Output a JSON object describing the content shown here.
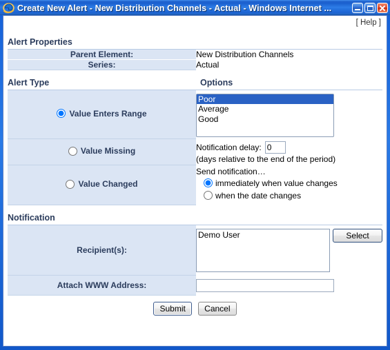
{
  "window": {
    "title": "Create New Alert - New Distribution Channels - Actual - Windows Internet ...",
    "icon": "internet-explorer-icon",
    "minimize_label": "Minimize",
    "maximize_label": "Maximize",
    "close_label": "Close",
    "titlebar_color": "#1f63d0",
    "close_button_color": "#cc2f11"
  },
  "page": {
    "help_link": "[ Help ]",
    "sections": {
      "alert_properties": {
        "heading": "Alert Properties",
        "rows": [
          {
            "label": "Parent Element:",
            "value": "New Distribution Channels"
          },
          {
            "label": "Series:",
            "value": "Actual"
          }
        ]
      },
      "alert_type": {
        "heading": "Alert Type",
        "options_heading": "Options",
        "radios": [
          {
            "label": "Value Enters Range",
            "selected": true
          },
          {
            "label": "Value Missing",
            "selected": false
          },
          {
            "label": "Value Changed",
            "selected": false
          }
        ],
        "options_list": {
          "items": [
            "Poor",
            "Average",
            "Good"
          ],
          "selected": "Poor",
          "selected_bg": "#2a62c4"
        },
        "notification_delay": {
          "label": "Notification delay:",
          "value": "0",
          "hint": "(days relative to the end of the period)"
        },
        "send_notification": {
          "label": "Send notification…",
          "choices": [
            {
              "label": "immediately when value changes",
              "selected": true
            },
            {
              "label": "when the date changes",
              "selected": false
            }
          ]
        }
      },
      "notification": {
        "heading": "Notification",
        "recipients": {
          "label": "Recipient(s):",
          "value": "Demo User",
          "select_button": "Select"
        },
        "attach_www": {
          "label": "Attach WWW Address:",
          "value": "",
          "placeholder": ""
        }
      }
    },
    "footer": {
      "submit_label": "Submit",
      "cancel_label": "Cancel"
    }
  }
}
